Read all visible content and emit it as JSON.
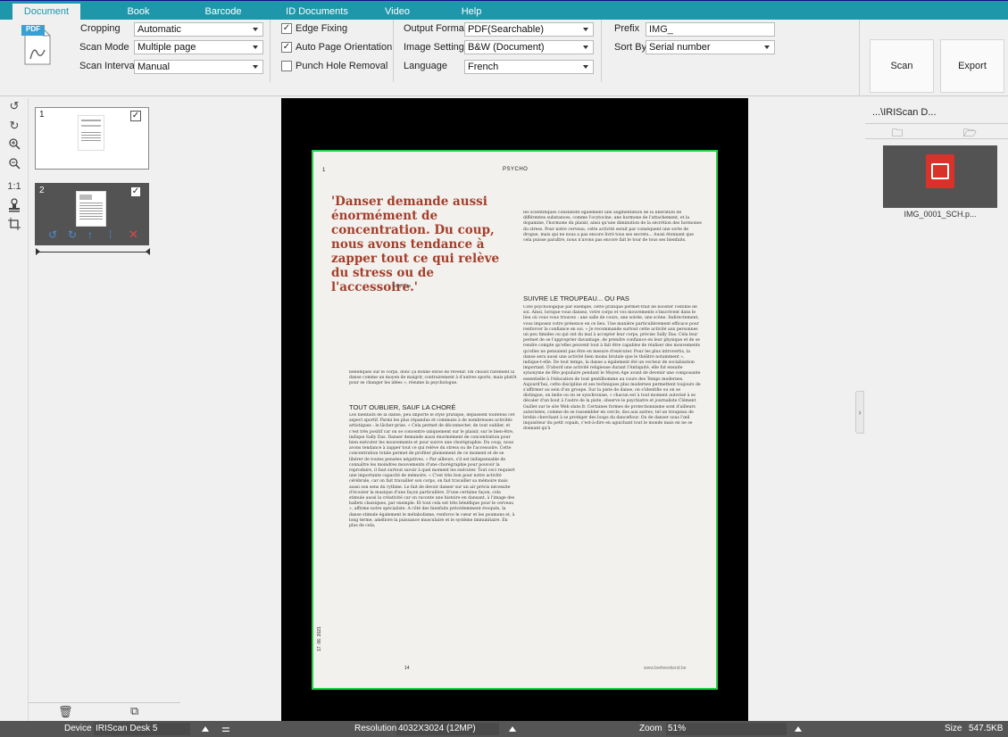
{
  "tabs": [
    {
      "label": "Document",
      "active": true
    },
    {
      "label": "Book"
    },
    {
      "label": "Barcode"
    },
    {
      "label": "ID Documents"
    },
    {
      "label": "Video"
    },
    {
      "label": "Help"
    }
  ],
  "ribbon": {
    "pdf_icon_label": "PDF",
    "cropping": {
      "label": "Cropping",
      "value": "Automatic"
    },
    "scan_mode": {
      "label": "Scan Mode",
      "value": "Multiple page"
    },
    "scan_interval": {
      "label": "Scan Interval",
      "value": "Manual"
    },
    "edge_fixing": {
      "label": "Edge Fixing",
      "checked": true
    },
    "auto_orientation": {
      "label": "Auto Page Orientation",
      "checked": true
    },
    "punch_hole": {
      "label": "Punch Hole Removal",
      "checked": false
    },
    "output_format": {
      "label": "Output Format",
      "value": "PDF(Searchable)"
    },
    "image_settings": {
      "label": "Image Settings",
      "value": "B&W (Document)"
    },
    "language": {
      "label": "Language",
      "value": "French"
    },
    "prefix": {
      "label": "Prefix",
      "value": "IMG_"
    },
    "sort_by": {
      "label": "Sort By",
      "value": "Serial number"
    },
    "scan_button": "Scan",
    "export_button": "Export"
  },
  "left_tools": [
    "rotate-left-icon",
    "rotate-right-icon",
    "zoom-in-icon",
    "zoom-out-icon",
    "actual-size-icon",
    "stamp-icon",
    "crop-icon"
  ],
  "left_tools_labels": {
    "actual_size": "1:1"
  },
  "thumbnails": [
    {
      "number": "1",
      "checked": true
    },
    {
      "number": "2",
      "checked": true,
      "selected": true
    }
  ],
  "document": {
    "page_number": "1",
    "header": "PSYCHO",
    "quote": "'Danser demande aussi énormément de concentration. Du coup, nous avons tendance à zapper tout ce qui relève du stress ou de l'accessoire.'",
    "quote_author": "Sally Das",
    "right_col_top": "les scientifiques constatent également une augmentation de la libération de différentes substances, comme l'ocytocine, une hormone de l'attachement, et la dopamine, l'hormone du plaisir, ainsi qu'une diminution de la sécrétion des hormones du stress. Pour notre cerveau, cette activité serait par conséquent une sorte de drogue, mais qui ne nous a pas encore livré tous ses secrets... Aussi étonnant que cela puisse paraître, nous n'avons pas encore fait le tour de tous ses bienfaits.",
    "subheading_right": "SUIVRE LE TROUPEAU... OU PAS",
    "right_col_body": "Côté psychologique par exemple, cette pratique permet-trait de booster l'estime de soi. Ainsi, lorsque vous dansez, votre corps et vos mouvements s'inscrivent dans le lieu où vous vous trouvez : une salle de cours, une soirée, une scène. Indirectement, vous imposez votre présence en ce lieu. Une manière particulièrement efficace pour renforcer la confiance en soi. « Je recommande surtout cette activité aux personnes un peu timides ou qui ont du mal à accepter leur corps, précise Sally Das. Cela leur permet de se l'approprier davantage, de prendre confiance en leur physique et de se rendre compte qu'elles peuvent tout à fait être capables de réaliser des mouvements qu'elles ne pensaient pas être en mesure d'exécuter. Pour les plus introvertis, la danse sera aussi une activité bien moins brutale que le théâtre notamment », indique-t-elle. De tout temps, la danse a également été un vecteur de socialisation important. D'abord une activité religieuse durant l'Antiquité, elle fut ensuite synonyme de fête populaire pendant le Moyen Age avant de devenir une composante essentielle à l'éducation de tout gentilhomme au cours des Temps modernes. Aujourd'hui, cette discipline et ses techniques plus modernes permettent toujours de s'affirmer au sein d'un groupe. Sur la piste de danse, on s'identifie ou on se distingue, on imite ou on se synchronise, « chacun est à tout moment autorisé à se décaler d'un bout à l'autre de la piste, observe le psychiatre et journaliste Clément Guillet sur le site Web slate.fr. Certaines formes de protectionnisme sont d'ailleurs autorisées, comme de se rassembler en cercle, dos aux autres, tel un troupeau de brebis cherchant à se protéger des loups du danceflour. Ou de danser sous l'œil inquisiteur du petit copain, c'est-à-dire en aguichant tout le monde mais en ne se donnant qu'à",
    "left_col_top": "bénéfiques sur le corps, donc ça donne envie de revenir. On choisit rarement la danse comme un moyen de maigrir, contrairement à d'autres sports, mais plutôt pour se changer les idées », résume la psychologue.",
    "subheading_left": "TOUT OUBLIER, SAUF LA CHORÉ",
    "left_col_body": "Les bienfaits de la danse, peu importe le style pratiqué, dépassent toutefois cet aspect sportif. Parmi les plus répandus et communs à de nombreuses activités artistiques : le lâcher-prise. « Cela permet de déconnecter, de tout oublier, et c'est très positif car on se concentre uniquement sur le plaisir, sur le bien-être, indique Sally Das. Danser demande aussi énormément de concentration pour bien exécuter les mouvements et pour suivre une chorégraphie. Du coup, nous avons tendance à zapper tout ce qui relève du stress ou de l'accessoire. Cette concentration totale permet de profiter pleinement de ce moment et de se libérer de toutes pensées négatives. » Par ailleurs, s'il est indispensable de connaître les moindres mouvements d'une chorégraphie pour pouvoir la reproduire, il faut surtout savoir à quel moment les exécuter. Tout ceci requiert une importante capacité de mémoire. « C'est très bon pour notre activité cérébrale, car on fait travailler son corps, on fait travailler sa mémoire mais aussi son sens du rythme. Le fait de devoir danser sur un air précis nécessite d'écouter la musique d'une façon particulière. D'une certaine façon, cela stimule aussi la créativité car on raconte une histoire en dansant, à l'image des ballets classiques, par exemple. Et tout cela est très bénéfique pour le cerveau », affirme notre spécialiste. A côté des bienfaits précédemment évoqués, la danse stimule également le métabolisme, renforce le cœur et les poumons et, à long terme, améliore la puissance musculaire et le système immunitaire. En plus de cela,",
    "footer_page": "14",
    "footer_site": "www.brefweekend.be",
    "side_date": "17. 06. 2021"
  },
  "right_panel": {
    "path": "...\\IRIScan D...",
    "file_name": "IMG_0001_SCH.p..."
  },
  "status": {
    "device_label": "Device",
    "device_value": "IRIScan Desk 5",
    "resolution_label": "Resolution",
    "resolution_value": "4032X3024 (12MP)",
    "zoom_label": "Zoom",
    "zoom_value": "51%",
    "size_label": "Size",
    "size_value": "547.5KB"
  },
  "colors": {
    "accent": "#1e97ab",
    "crop_border": "#24d24a",
    "quote_red": "#a53e2a",
    "pdf_red": "#d9322b"
  }
}
